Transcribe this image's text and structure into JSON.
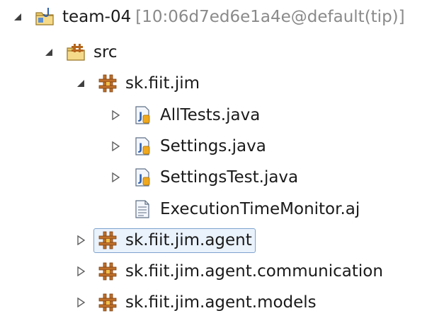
{
  "tree": {
    "project": {
      "name": "team-04",
      "meta": "[10:06d7ed6e1a4e@default(tip)]",
      "icon": "project-folder-icon"
    },
    "src": {
      "label": "src",
      "icon": "source-folder-icon"
    },
    "package_main": {
      "label": "sk.fiit.jim",
      "icon": "package-icon"
    },
    "files": [
      {
        "label": "AllTests.java",
        "icon": "java-file-icon"
      },
      {
        "label": "Settings.java",
        "icon": "java-file-icon"
      },
      {
        "label": "SettingsTest.java",
        "icon": "java-file-icon"
      },
      {
        "label": "ExecutionTimeMonitor.aj",
        "icon": "aspect-file-icon"
      }
    ],
    "packages": [
      {
        "label": "sk.fiit.jim.agent",
        "icon": "package-icon",
        "selected": true
      },
      {
        "label": "sk.fiit.jim.agent.communication",
        "icon": "package-icon"
      },
      {
        "label": "sk.fiit.jim.agent.models",
        "icon": "package-icon"
      }
    ]
  },
  "colors": {
    "selection_border": "#7da2ce",
    "selection_fill": "#eaf2fb",
    "meta_text": "#8a8a8a",
    "package_brown": "#b5651d"
  }
}
